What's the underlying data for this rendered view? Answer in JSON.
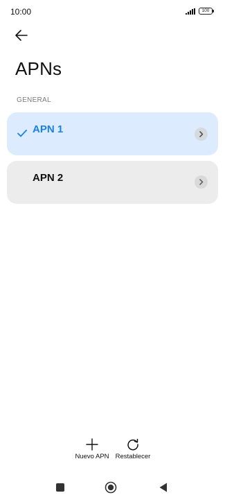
{
  "status_bar": {
    "time": "10:00",
    "battery": "100",
    "icons": [
      "signal-icon",
      "battery-icon"
    ]
  },
  "header": {
    "back_icon": "arrow-left-icon",
    "title": "APNs"
  },
  "section": {
    "label": "GENERAL"
  },
  "apns": [
    {
      "label": "APN 1",
      "selected": true,
      "icon": "check-icon",
      "action_icon": "chevron-right-icon"
    },
    {
      "label": "APN 2",
      "selected": false,
      "action_icon": "chevron-right-icon"
    }
  ],
  "actions": {
    "new_apn": {
      "label": "Nuevo APN",
      "icon": "plus-icon"
    },
    "reset": {
      "label": "Restablecer",
      "icon": "refresh-icon"
    }
  },
  "navigation": {
    "icons": [
      "recents-square-icon",
      "home-circle-icon",
      "back-triangle-icon"
    ]
  },
  "colors": {
    "accent": "#1a80e6",
    "selected_card_bg": "#dcebfe",
    "card_bg": "#ececec",
    "chevron_bg": "#d6d9de"
  }
}
